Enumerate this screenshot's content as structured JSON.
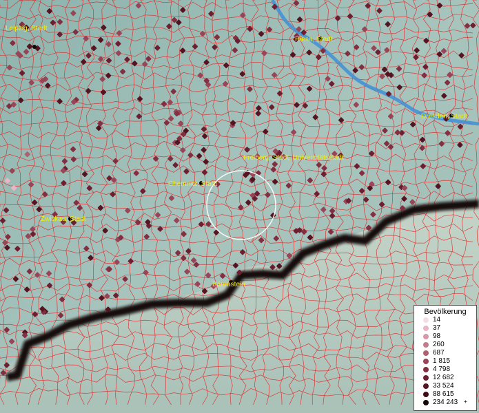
{
  "map": {
    "cities": [
      {
        "name": "Leipzig, Stadt"
      },
      {
        "name": "Riesa, Stadt"
      },
      {
        "name": "Dresden, Stadt"
      },
      {
        "name": "Freiberg, Stadt, Universitätsstadt"
      },
      {
        "name": "Chemnitz, Stadt"
      },
      {
        "name": "Zwickau, Stadt"
      },
      {
        "name": "Bärenstein"
      }
    ]
  },
  "legend": {
    "title": "Bevölkerung",
    "entries": [
      {
        "label": "14",
        "color": "#f5dde8"
      },
      {
        "label": "37",
        "color": "#e9b6c8"
      },
      {
        "label": "98",
        "color": "#d59aaa"
      },
      {
        "label": "260",
        "color": "#c27d8c"
      },
      {
        "label": "687",
        "color": "#ad6070"
      },
      {
        "label": "1 815",
        "color": "#984558"
      },
      {
        "label": "4 798",
        "color": "#822f42"
      },
      {
        "label": "12 682",
        "color": "#6c1f30"
      },
      {
        "label": "33 524",
        "color": "#551421"
      },
      {
        "label": "88 615",
        "color": "#3d0c15"
      },
      {
        "label": "234 243",
        "color": "#12090a",
        "suffix": "+"
      }
    ]
  },
  "colors": {
    "boundary": "#e62020",
    "river": "#3f8fd6",
    "mountain_ridge": "#120b08",
    "city_label": "#f0f000"
  }
}
